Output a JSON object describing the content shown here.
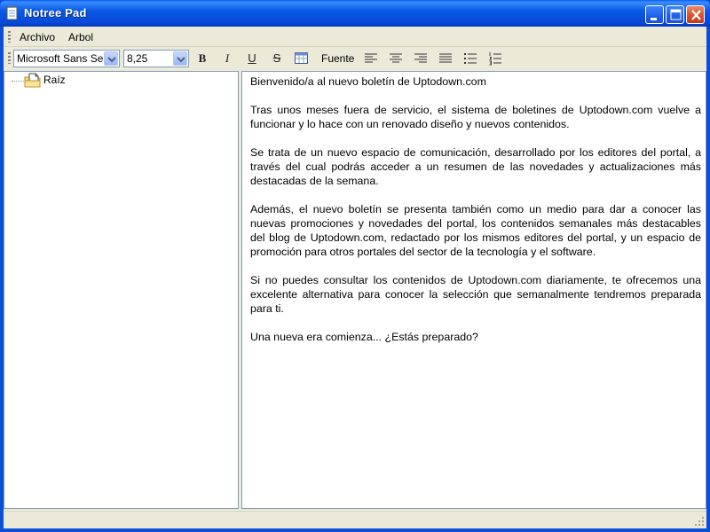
{
  "window": {
    "title": "Notree Pad",
    "minimize_icon": "minimize-icon",
    "maximize_icon": "maximize-icon",
    "close_icon": "close-icon"
  },
  "menu": {
    "items": [
      {
        "label": "Archivo"
      },
      {
        "label": "Arbol"
      }
    ]
  },
  "toolbar": {
    "font_name": "Microsoft Sans Serif",
    "font_size": "8,25",
    "bold_label": "B",
    "italic_label": "I",
    "underline_label": "U",
    "strike_label": "S",
    "font_button_label": "Fuente",
    "icons": [
      "table-icon",
      "align-left-icon",
      "align-center-icon",
      "align-right-icon",
      "justify-icon",
      "bulleted-list-icon",
      "numbered-list-icon"
    ]
  },
  "tree": {
    "root_label": "Raíz",
    "root_icon": "folder-document-icon"
  },
  "editor": {
    "paragraphs": [
      "Bienvenido/a al nuevo boletín de Uptodown.com",
      "Tras unos meses fuera de servicio, el sistema de boletines de Uptodown.com vuelve a funcionar y lo hace con un renovado diseño y nuevos contenidos.",
      "Se trata de un nuevo espacio de comunicación, desarrollado por los editores del portal, a través del cual podrás acceder a un resumen de las novedades y actualizaciones más destacadas de la semana.",
      "Además, el nuevo boletín se presenta también como un medio para dar a conocer las nuevas promociones y novedades del portal, los contenidos semanales más destacables del blog de Uptodown.com, redactado por los mismos editores del portal, y un espacio de promoción para otros portales del sector de la tecnología y el software.",
      "Si no puedes consultar los contenidos de Uptodown.com diariamente, te ofrecemos una excelente alternativa para conocer la selección que semanalmente tendremos preparada para ti.",
      "Una nueva era comienza... ¿Estás preparado?"
    ]
  },
  "colors": {
    "titlebar": "#0a5ae6",
    "chrome": "#ece9d8",
    "border": "#7f9db9"
  }
}
